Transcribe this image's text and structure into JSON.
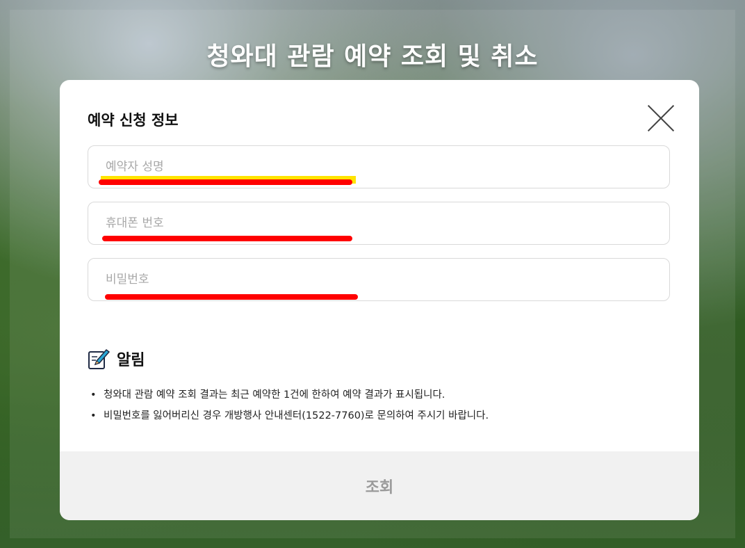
{
  "page": {
    "title": "청와대 관람 예약 조회 및 취소"
  },
  "modal": {
    "section_title": "예약 신청 정보",
    "close_icon": "close-icon",
    "fields": {
      "name": {
        "placeholder": "예약자 성명",
        "value": ""
      },
      "phone": {
        "placeholder": "휴대폰 번호",
        "value": ""
      },
      "password": {
        "placeholder": "비밀번호",
        "value": ""
      }
    },
    "notice": {
      "icon": "memo-pencil-icon",
      "label": "알림",
      "items": [
        "청와대 관람 예약 조회 결과는 최근 예약한 1건에 한하여 예약 결과가 표시됩니다.",
        "비밀번호를 잃어버리신 경우 개방행사 안내센터(1522-7760)로 문의하여 주시기 바랍니다."
      ]
    },
    "submit_label": "조회"
  },
  "colors": {
    "annotation_red": "#ff0000",
    "annotation_yellow": "#ffe400",
    "button_bg": "#f1f1f1",
    "button_text": "#9a9a9a"
  }
}
